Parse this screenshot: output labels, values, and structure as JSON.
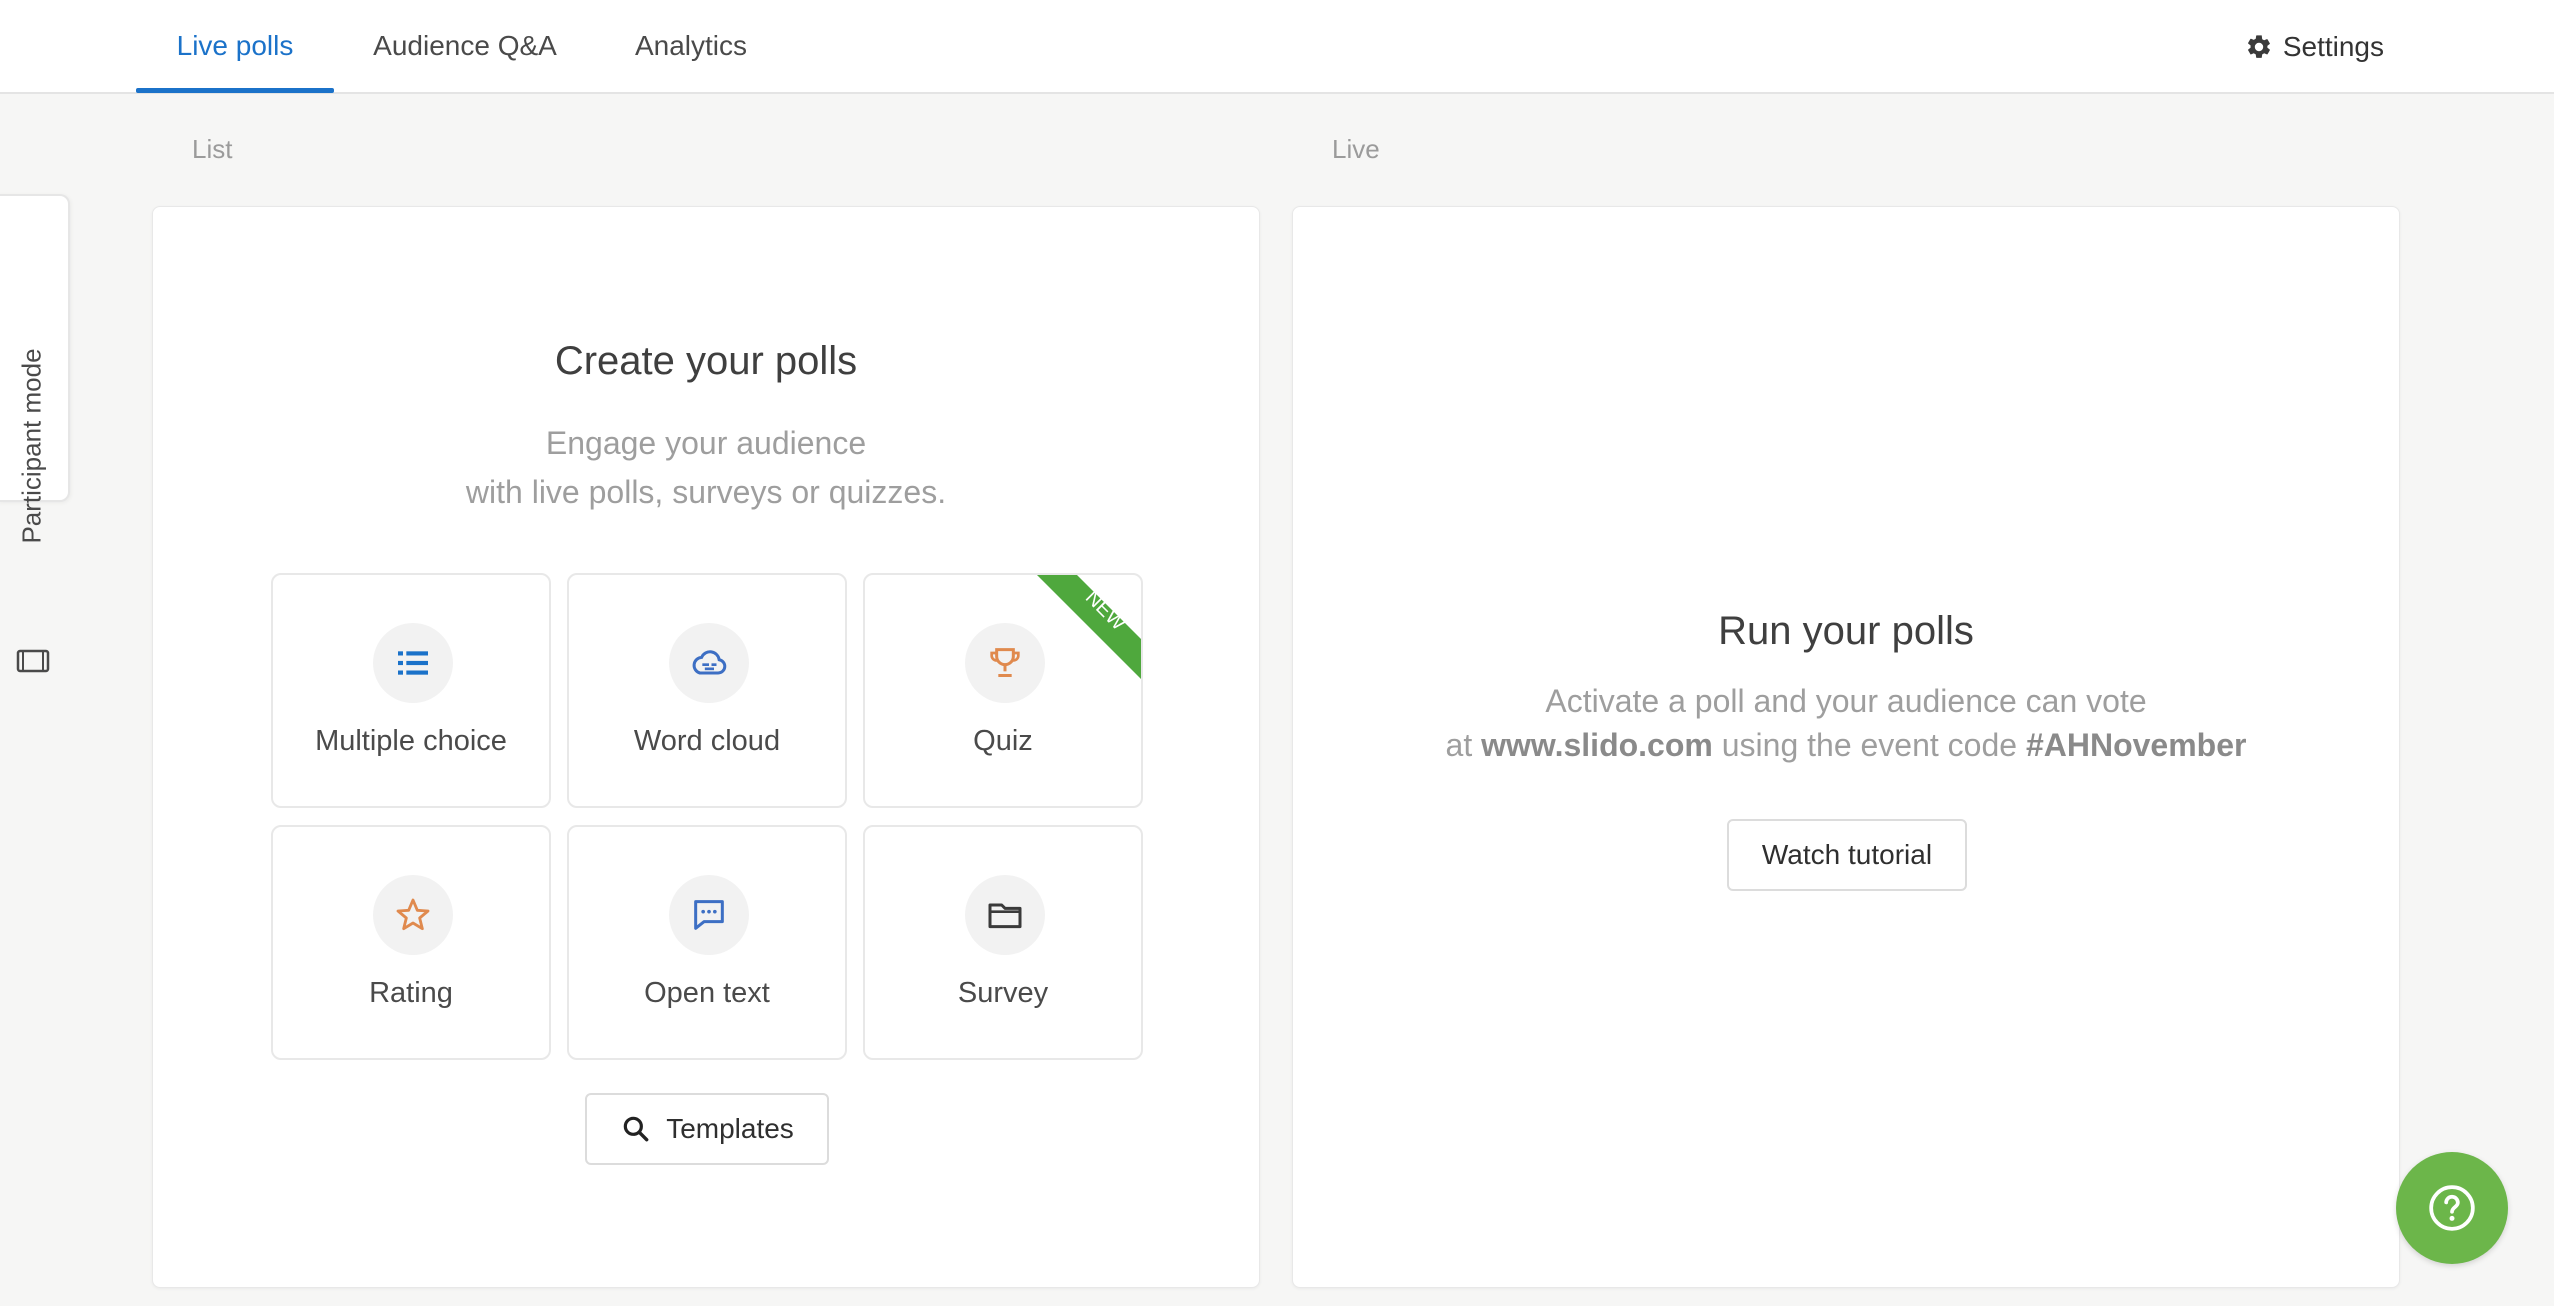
{
  "nav": {
    "tabs": [
      {
        "label": "Live polls",
        "active": true
      },
      {
        "label": "Audience Q&A",
        "active": false
      },
      {
        "label": "Analytics",
        "active": false
      }
    ],
    "settings_label": "Settings"
  },
  "participant_mode": {
    "label": "Participant mode"
  },
  "sections": {
    "list_label": "List",
    "live_label": "Live"
  },
  "create": {
    "title": "Create your polls",
    "subtitle_line1": "Engage your audience",
    "subtitle_line2": "with live polls, surveys or quizzes.",
    "tiles": [
      {
        "label": "Multiple choice",
        "icon": "list-icon"
      },
      {
        "label": "Word cloud",
        "icon": "cloud-icon"
      },
      {
        "label": "Quiz",
        "icon": "trophy-icon",
        "badge": "NEW"
      },
      {
        "label": "Rating",
        "icon": "star-icon"
      },
      {
        "label": "Open text",
        "icon": "chat-bubble-icon"
      },
      {
        "label": "Survey",
        "icon": "folder-icon"
      }
    ],
    "templates_label": "Templates"
  },
  "run": {
    "title": "Run your polls",
    "line1": "Activate a poll and your audience can vote",
    "line2_prefix": "at ",
    "site": "www.slido.com",
    "line2_mid": " using the event code ",
    "event_code": "#AHNovember",
    "watch_tutorial_label": "Watch tutorial"
  },
  "colors": {
    "accent_blue": "#1b72c9",
    "help_green": "#6cb64a",
    "new_ribbon_green": "#4fa83d",
    "quiz_orange": "#e08a4e"
  }
}
